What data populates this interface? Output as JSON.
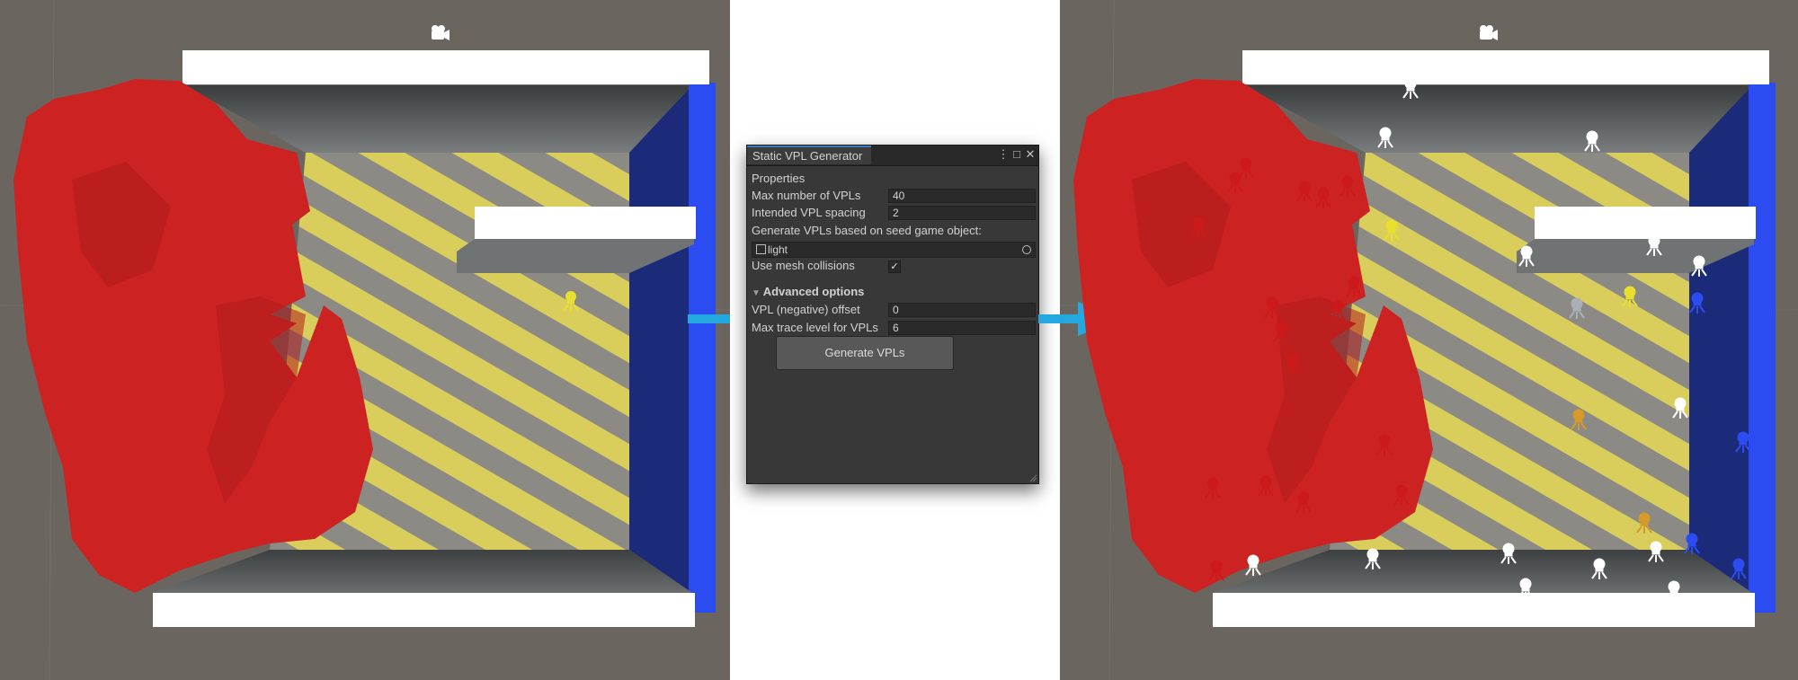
{
  "panel": {
    "title": "Static VPL Generator",
    "section_title": "Properties",
    "max_vpls_label": "Max number of VPLs",
    "max_vpls_value": "40",
    "spacing_label": "Intended VPL spacing",
    "spacing_value": "2",
    "seed_label": "Generate VPLs based on seed game object:",
    "seed_object": "light",
    "mesh_collisions_label": "Use mesh collisions",
    "mesh_collisions_checked": true,
    "advanced_label": "Advanced options",
    "offset_label": "VPL (negative) offset",
    "offset_value": "0",
    "trace_label": "Max trace level for VPLs",
    "trace_value": "6",
    "generate_button": "Generate VPLs"
  },
  "scene": {
    "background_color": "#6b6560",
    "rock_color": "#cc2222",
    "floor_colors": [
      "#d8cc5a",
      "#8a8a86"
    ],
    "right_wall_color": "#1c2a7a",
    "right_wall_edge_color": "#2a4cf0",
    "arrow_color": "#23a8e0",
    "camera_icon": "camera-gizmo-icon",
    "light_icon": "point-light-gizmo-icon"
  }
}
